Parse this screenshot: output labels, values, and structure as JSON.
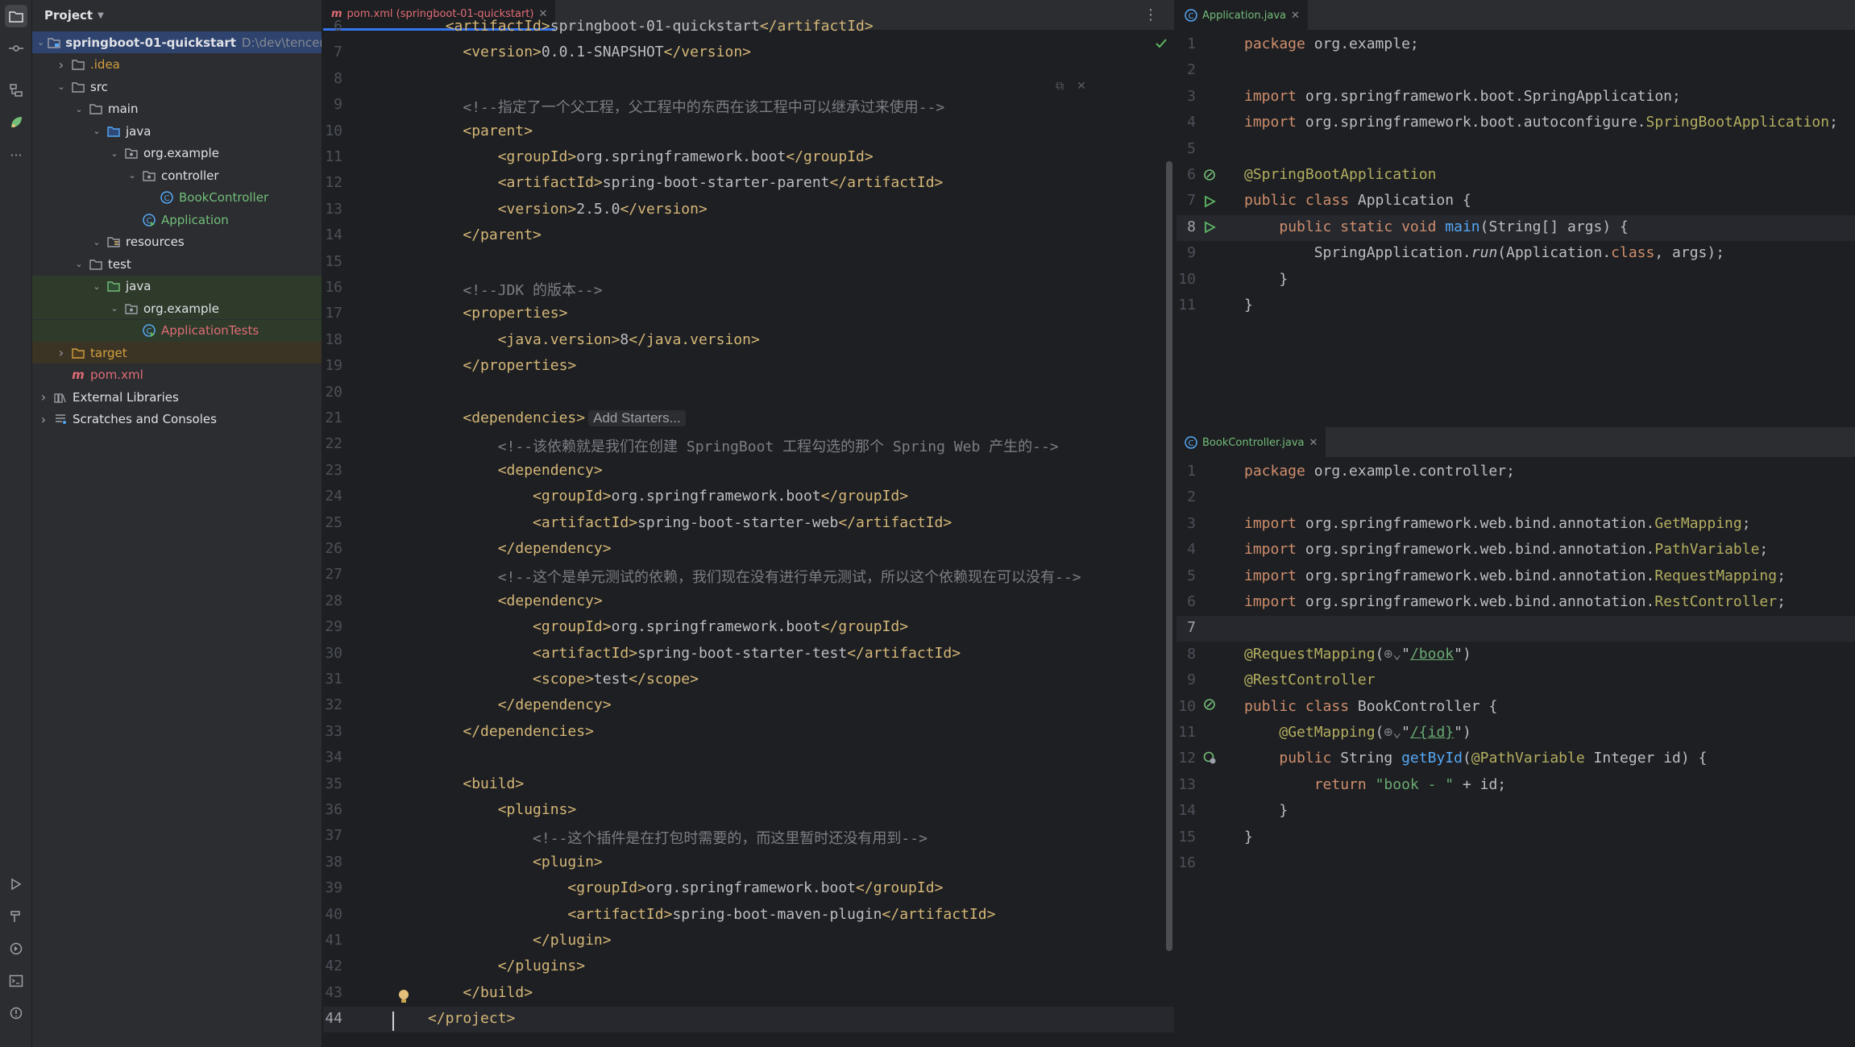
{
  "project_panel": {
    "title": "Project",
    "tree": [
      {
        "label": "springboot-01-quickstart",
        "path": "D:\\dev\\tencent",
        "depth": 0,
        "expanded": true,
        "kind": "module",
        "color": "default",
        "bold": true,
        "selected": true
      },
      {
        "label": ".idea",
        "depth": 1,
        "expanded": false,
        "kind": "folder",
        "color": "excluded"
      },
      {
        "label": "src",
        "depth": 1,
        "expanded": true,
        "kind": "folder",
        "color": "default"
      },
      {
        "label": "main",
        "depth": 2,
        "expanded": true,
        "kind": "folder",
        "color": "default"
      },
      {
        "label": "java",
        "depth": 3,
        "expanded": true,
        "kind": "source-folder",
        "color": "default"
      },
      {
        "label": "org.example",
        "depth": 4,
        "expanded": true,
        "kind": "package",
        "color": "default"
      },
      {
        "label": "controller",
        "depth": 5,
        "expanded": true,
        "kind": "package",
        "color": "default"
      },
      {
        "label": "BookController",
        "depth": 6,
        "kind": "class",
        "color": "green"
      },
      {
        "label": "Application",
        "depth": 5,
        "kind": "class-run",
        "color": "green"
      },
      {
        "label": "resources",
        "depth": 3,
        "expanded": true,
        "kind": "resources-folder",
        "color": "default"
      },
      {
        "label": "test",
        "depth": 2,
        "expanded": true,
        "kind": "folder",
        "color": "default"
      },
      {
        "label": "java",
        "depth": 3,
        "expanded": true,
        "kind": "test-folder",
        "color": "default",
        "highlight": "test"
      },
      {
        "label": "org.example",
        "depth": 4,
        "expanded": true,
        "kind": "package",
        "color": "default",
        "highlight": "test"
      },
      {
        "label": "ApplicationTests",
        "depth": 5,
        "kind": "class-run",
        "color": "red",
        "highlight": "test"
      },
      {
        "label": "target",
        "depth": 1,
        "expanded": false,
        "kind": "excluded-folder",
        "color": "excluded",
        "highlight": "excluded"
      },
      {
        "label": "pom.xml",
        "depth": 1,
        "kind": "maven",
        "color": "red"
      },
      {
        "label": "External Libraries",
        "depth": 0,
        "expanded": false,
        "kind": "libraries",
        "color": "default"
      },
      {
        "label": "Scratches and Consoles",
        "depth": 0,
        "expanded": false,
        "kind": "scratches",
        "color": "default"
      }
    ]
  },
  "left_editor": {
    "tab": {
      "label": "pom.xml (springboot-01-quickstart)",
      "icon": "maven-icon"
    },
    "first_line": 6,
    "current_line": 44,
    "chip": "Add Starters...",
    "lines": [
      [
        [
          "  ",
          ""
        ],
        [
          "<artifactId>",
          "t-tag"
        ],
        [
          "springboot-01-quickstart",
          ""
        ],
        [
          "</artifactId>",
          "t-tag"
        ]
      ],
      [
        [
          "    ",
          ""
        ],
        [
          "<version>",
          "t-tag"
        ],
        [
          "0.0.1-SNAPSHOT",
          ""
        ],
        [
          "</version>",
          "t-tag"
        ]
      ],
      [],
      [
        [
          "    ",
          ""
        ],
        [
          "<!--指定了一个父工程，父工程中的东西在该工程中可以继承过来使用-->",
          "t-cm"
        ]
      ],
      [
        [
          "    ",
          ""
        ],
        [
          "<parent>",
          "t-tag"
        ]
      ],
      [
        [
          "        ",
          ""
        ],
        [
          "<groupId>",
          "t-tag"
        ],
        [
          "org.springframework.boot",
          ""
        ],
        [
          "</groupId>",
          "t-tag"
        ]
      ],
      [
        [
          "        ",
          ""
        ],
        [
          "<artifactId>",
          "t-tag"
        ],
        [
          "spring-boot-starter-parent",
          ""
        ],
        [
          "</artifactId>",
          "t-tag"
        ]
      ],
      [
        [
          "        ",
          ""
        ],
        [
          "<version>",
          "t-tag"
        ],
        [
          "2.5.0",
          ""
        ],
        [
          "</version>",
          "t-tag"
        ]
      ],
      [
        [
          "    ",
          ""
        ],
        [
          "</parent>",
          "t-tag"
        ]
      ],
      [],
      [
        [
          "    ",
          ""
        ],
        [
          "<!--JDK 的版本-->",
          "t-cm"
        ]
      ],
      [
        [
          "    ",
          ""
        ],
        [
          "<properties>",
          "t-tag"
        ]
      ],
      [
        [
          "        ",
          ""
        ],
        [
          "<java.version>",
          "t-tag"
        ],
        [
          "8",
          ""
        ],
        [
          "</java.version>",
          "t-tag"
        ]
      ],
      [
        [
          "    ",
          ""
        ],
        [
          "</properties>",
          "t-tag"
        ]
      ],
      [],
      [
        [
          "    ",
          ""
        ],
        [
          "<dependencies>",
          "t-tag"
        ],
        [
          "Add Starters...",
          "chip"
        ]
      ],
      [
        [
          "        ",
          ""
        ],
        [
          "<!--该依赖就是我们在创建 SpringBoot 工程勾选的那个 Spring Web 产生的-->",
          "t-cm"
        ]
      ],
      [
        [
          "        ",
          ""
        ],
        [
          "<dependency>",
          "t-tag"
        ]
      ],
      [
        [
          "            ",
          ""
        ],
        [
          "<groupId>",
          "t-tag"
        ],
        [
          "org.springframework.boot",
          ""
        ],
        [
          "</groupId>",
          "t-tag"
        ]
      ],
      [
        [
          "            ",
          ""
        ],
        [
          "<artifactId>",
          "t-tag"
        ],
        [
          "spring-boot-starter-web",
          ""
        ],
        [
          "</artifactId>",
          "t-tag"
        ]
      ],
      [
        [
          "        ",
          ""
        ],
        [
          "</dependency>",
          "t-tag"
        ]
      ],
      [
        [
          "        ",
          ""
        ],
        [
          "<!--这个是单元测试的依赖，我们现在没有进行单元测试，所以这个依赖现在可以没有-->",
          "t-cm"
        ]
      ],
      [
        [
          "        ",
          ""
        ],
        [
          "<dependency>",
          "t-tag"
        ]
      ],
      [
        [
          "            ",
          ""
        ],
        [
          "<groupId>",
          "t-tag"
        ],
        [
          "org.springframework.boot",
          ""
        ],
        [
          "</groupId>",
          "t-tag"
        ]
      ],
      [
        [
          "            ",
          ""
        ],
        [
          "<artifactId>",
          "t-tag"
        ],
        [
          "spring-boot-starter-test",
          ""
        ],
        [
          "</artifactId>",
          "t-tag"
        ]
      ],
      [
        [
          "            ",
          ""
        ],
        [
          "<scope>",
          "t-tag"
        ],
        [
          "test",
          ""
        ],
        [
          "</scope>",
          "t-tag"
        ]
      ],
      [
        [
          "        ",
          ""
        ],
        [
          "</dependency>",
          "t-tag"
        ]
      ],
      [
        [
          "    ",
          ""
        ],
        [
          "</dependencies>",
          "t-tag"
        ]
      ],
      [],
      [
        [
          "    ",
          ""
        ],
        [
          "<build>",
          "t-tag"
        ]
      ],
      [
        [
          "        ",
          ""
        ],
        [
          "<plugins>",
          "t-tag"
        ]
      ],
      [
        [
          "            ",
          ""
        ],
        [
          "<!--这个插件是在打包时需要的，而这里暂时还没有用到-->",
          "t-cm"
        ]
      ],
      [
        [
          "            ",
          ""
        ],
        [
          "<plugin>",
          "t-tag"
        ]
      ],
      [
        [
          "                ",
          ""
        ],
        [
          "<groupId>",
          "t-tag"
        ],
        [
          "org.springframework.boot",
          ""
        ],
        [
          "</groupId>",
          "t-tag"
        ]
      ],
      [
        [
          "                ",
          ""
        ],
        [
          "<artifactId>",
          "t-tag"
        ],
        [
          "spring-boot-maven-plugin",
          ""
        ],
        [
          "</artifactId>",
          "t-tag"
        ]
      ],
      [
        [
          "            ",
          ""
        ],
        [
          "</plugin>",
          "t-tag"
        ]
      ],
      [
        [
          "        ",
          ""
        ],
        [
          "</plugins>",
          "t-tag"
        ]
      ],
      [
        [
          "    ",
          ""
        ],
        [
          "</build>",
          "t-tag"
        ]
      ],
      [
        [
          "</project>",
          "t-tag"
        ]
      ]
    ]
  },
  "right_top_editor": {
    "tab": {
      "label": "Application.java",
      "icon": "class-icon"
    },
    "first_line": 1,
    "current_line": 8,
    "lines": [
      [
        [
          "package",
          "t-kw"
        ],
        [
          " org.example;",
          ""
        ]
      ],
      [],
      [
        [
          "import",
          "t-kw"
        ],
        [
          " org.springframework.boot.SpringApplication;",
          ""
        ]
      ],
      [
        [
          "import",
          "t-kw"
        ],
        [
          " org.springframework.boot.autoconfigure.",
          ""
        ],
        [
          "SpringBootApplication",
          "t-ann"
        ],
        [
          ";",
          ""
        ]
      ],
      [],
      [
        [
          "@SpringBootApplication",
          "t-ann"
        ]
      ],
      [
        [
          "public class",
          "t-kw"
        ],
        [
          " Application {",
          ""
        ]
      ],
      [
        [
          "    ",
          ""
        ],
        [
          "public static void",
          "t-kw"
        ],
        [
          " ",
          ""
        ],
        [
          "main",
          "t-fn"
        ],
        [
          "(String[] args) {",
          ""
        ]
      ],
      [
        [
          "        SpringApplication.",
          ""
        ],
        [
          "run",
          "t-it"
        ],
        [
          "(Application.",
          ""
        ],
        [
          "class",
          "t-kw"
        ],
        [
          ", args);",
          ""
        ]
      ],
      [
        [
          "    }",
          ""
        ]
      ],
      [
        [
          "}",
          ""
        ]
      ]
    ]
  },
  "right_bottom_editor": {
    "tab": {
      "label": "BookController.java",
      "icon": "class-icon"
    },
    "first_line": 1,
    "current_line": 7,
    "lines": [
      [
        [
          "package",
          "t-kw"
        ],
        [
          " org.example.controller;",
          ""
        ]
      ],
      [],
      [
        [
          "import",
          "t-kw"
        ],
        [
          " org.springframework.web.bind.annotation.",
          ""
        ],
        [
          "GetMapping",
          "t-ann"
        ],
        [
          ";",
          ""
        ]
      ],
      [
        [
          "import",
          "t-kw"
        ],
        [
          " org.springframework.web.bind.annotation.",
          ""
        ],
        [
          "PathVariable",
          "t-ann"
        ],
        [
          ";",
          ""
        ]
      ],
      [
        [
          "import",
          "t-kw"
        ],
        [
          " org.springframework.web.bind.annotation.",
          ""
        ],
        [
          "RequestMapping",
          "t-ann"
        ],
        [
          ";",
          ""
        ]
      ],
      [
        [
          "import",
          "t-kw"
        ],
        [
          " org.springframework.web.bind.annotation.",
          ""
        ],
        [
          "RestController",
          "t-ann"
        ],
        [
          ";",
          ""
        ]
      ],
      [],
      [
        [
          "@RequestMapping",
          "t-ann"
        ],
        [
          "(",
          ""
        ],
        [
          "⊕⌄",
          "t-cm"
        ],
        [
          "\"",
          ""
        ],
        [
          "/book",
          "t-link"
        ],
        [
          "\")",
          ""
        ]
      ],
      [
        [
          "@RestController",
          "t-ann"
        ]
      ],
      [
        [
          "public class",
          "t-kw"
        ],
        [
          " BookController {",
          ""
        ]
      ],
      [
        [
          "    ",
          ""
        ],
        [
          "@GetMapping",
          "t-ann"
        ],
        [
          "(",
          ""
        ],
        [
          "⊕⌄",
          "t-cm"
        ],
        [
          "\"",
          ""
        ],
        [
          "/{id}",
          "t-link"
        ],
        [
          "\")",
          ""
        ]
      ],
      [
        [
          "    ",
          ""
        ],
        [
          "public",
          "t-kw"
        ],
        [
          " String ",
          ""
        ],
        [
          "getById",
          "t-fn"
        ],
        [
          "(",
          ""
        ],
        [
          "@PathVariable",
          "t-ann"
        ],
        [
          " Integer id) {",
          ""
        ]
      ],
      [
        [
          "        ",
          ""
        ],
        [
          "return",
          "t-kw"
        ],
        [
          " ",
          ""
        ],
        [
          "\"book - \"",
          "t-str"
        ],
        [
          " + id;",
          ""
        ]
      ],
      [
        [
          "    }",
          ""
        ]
      ],
      [
        [
          "}",
          ""
        ]
      ],
      []
    ]
  }
}
